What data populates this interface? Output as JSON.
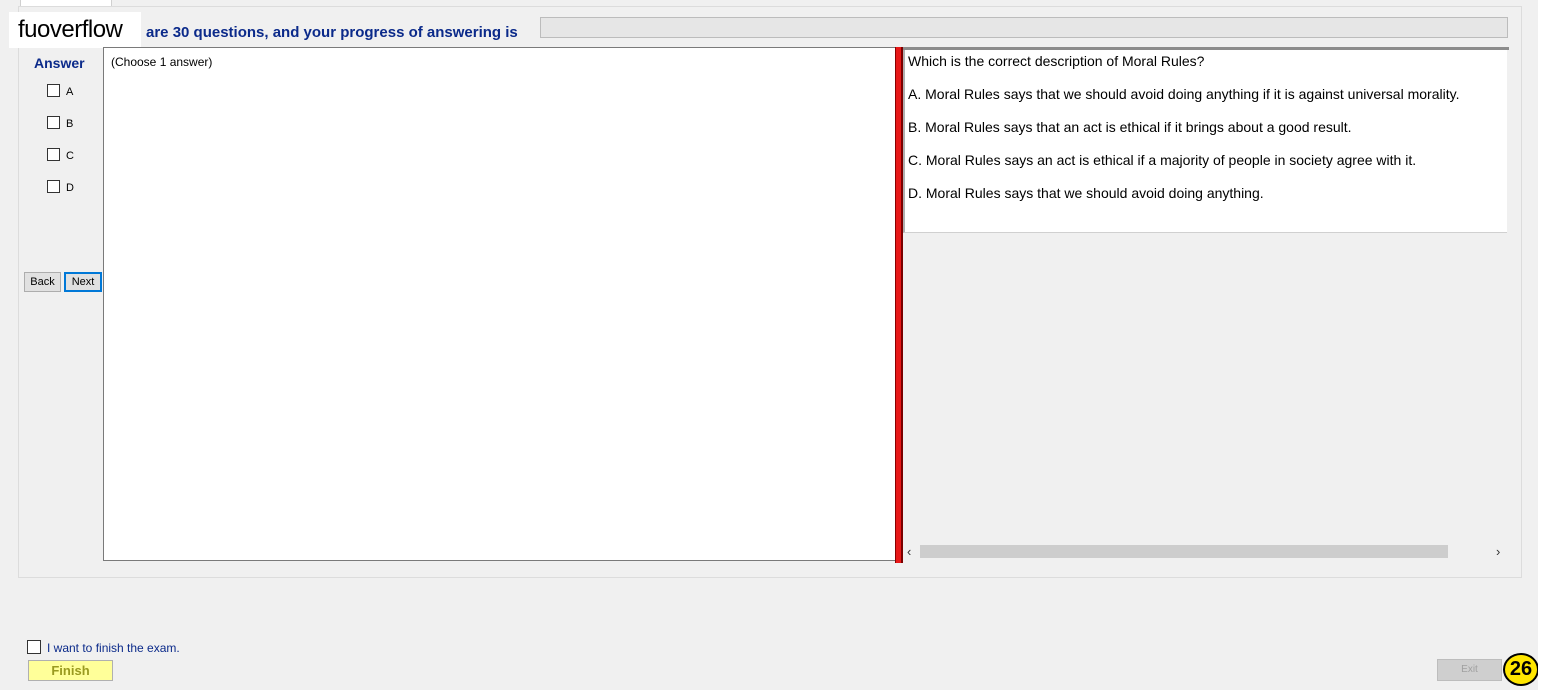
{
  "watermark": "fuoverflow",
  "header": {
    "progress_text": "are 30 questions, and your progress of answering is",
    "progress_value": 0
  },
  "answer_panel": {
    "title": "Answer",
    "options": [
      "A",
      "B",
      "C",
      "D"
    ],
    "back_label": "Back",
    "next_label": "Next"
  },
  "answer_area": {
    "instruction": "(Choose 1 answer)"
  },
  "question": {
    "text": "Which is the correct description of Moral Rules?",
    "choices": [
      "A.  Moral Rules says that we should avoid doing anything if it is against universal morality.",
      "B.  Moral Rules says that an act is ethical if it brings about a good result.",
      "C.  Moral Rules says an act is ethical if a majority of people in society agree with it.",
      "D.  Moral Rules says that we should avoid doing anything."
    ]
  },
  "scrollbar": {
    "left_arrow": "‹",
    "right_arrow": "›"
  },
  "footer": {
    "finish_check_label": "I want to finish the exam.",
    "finish_label": "Finish",
    "exit_label": "Exit",
    "badge_number": "26"
  }
}
